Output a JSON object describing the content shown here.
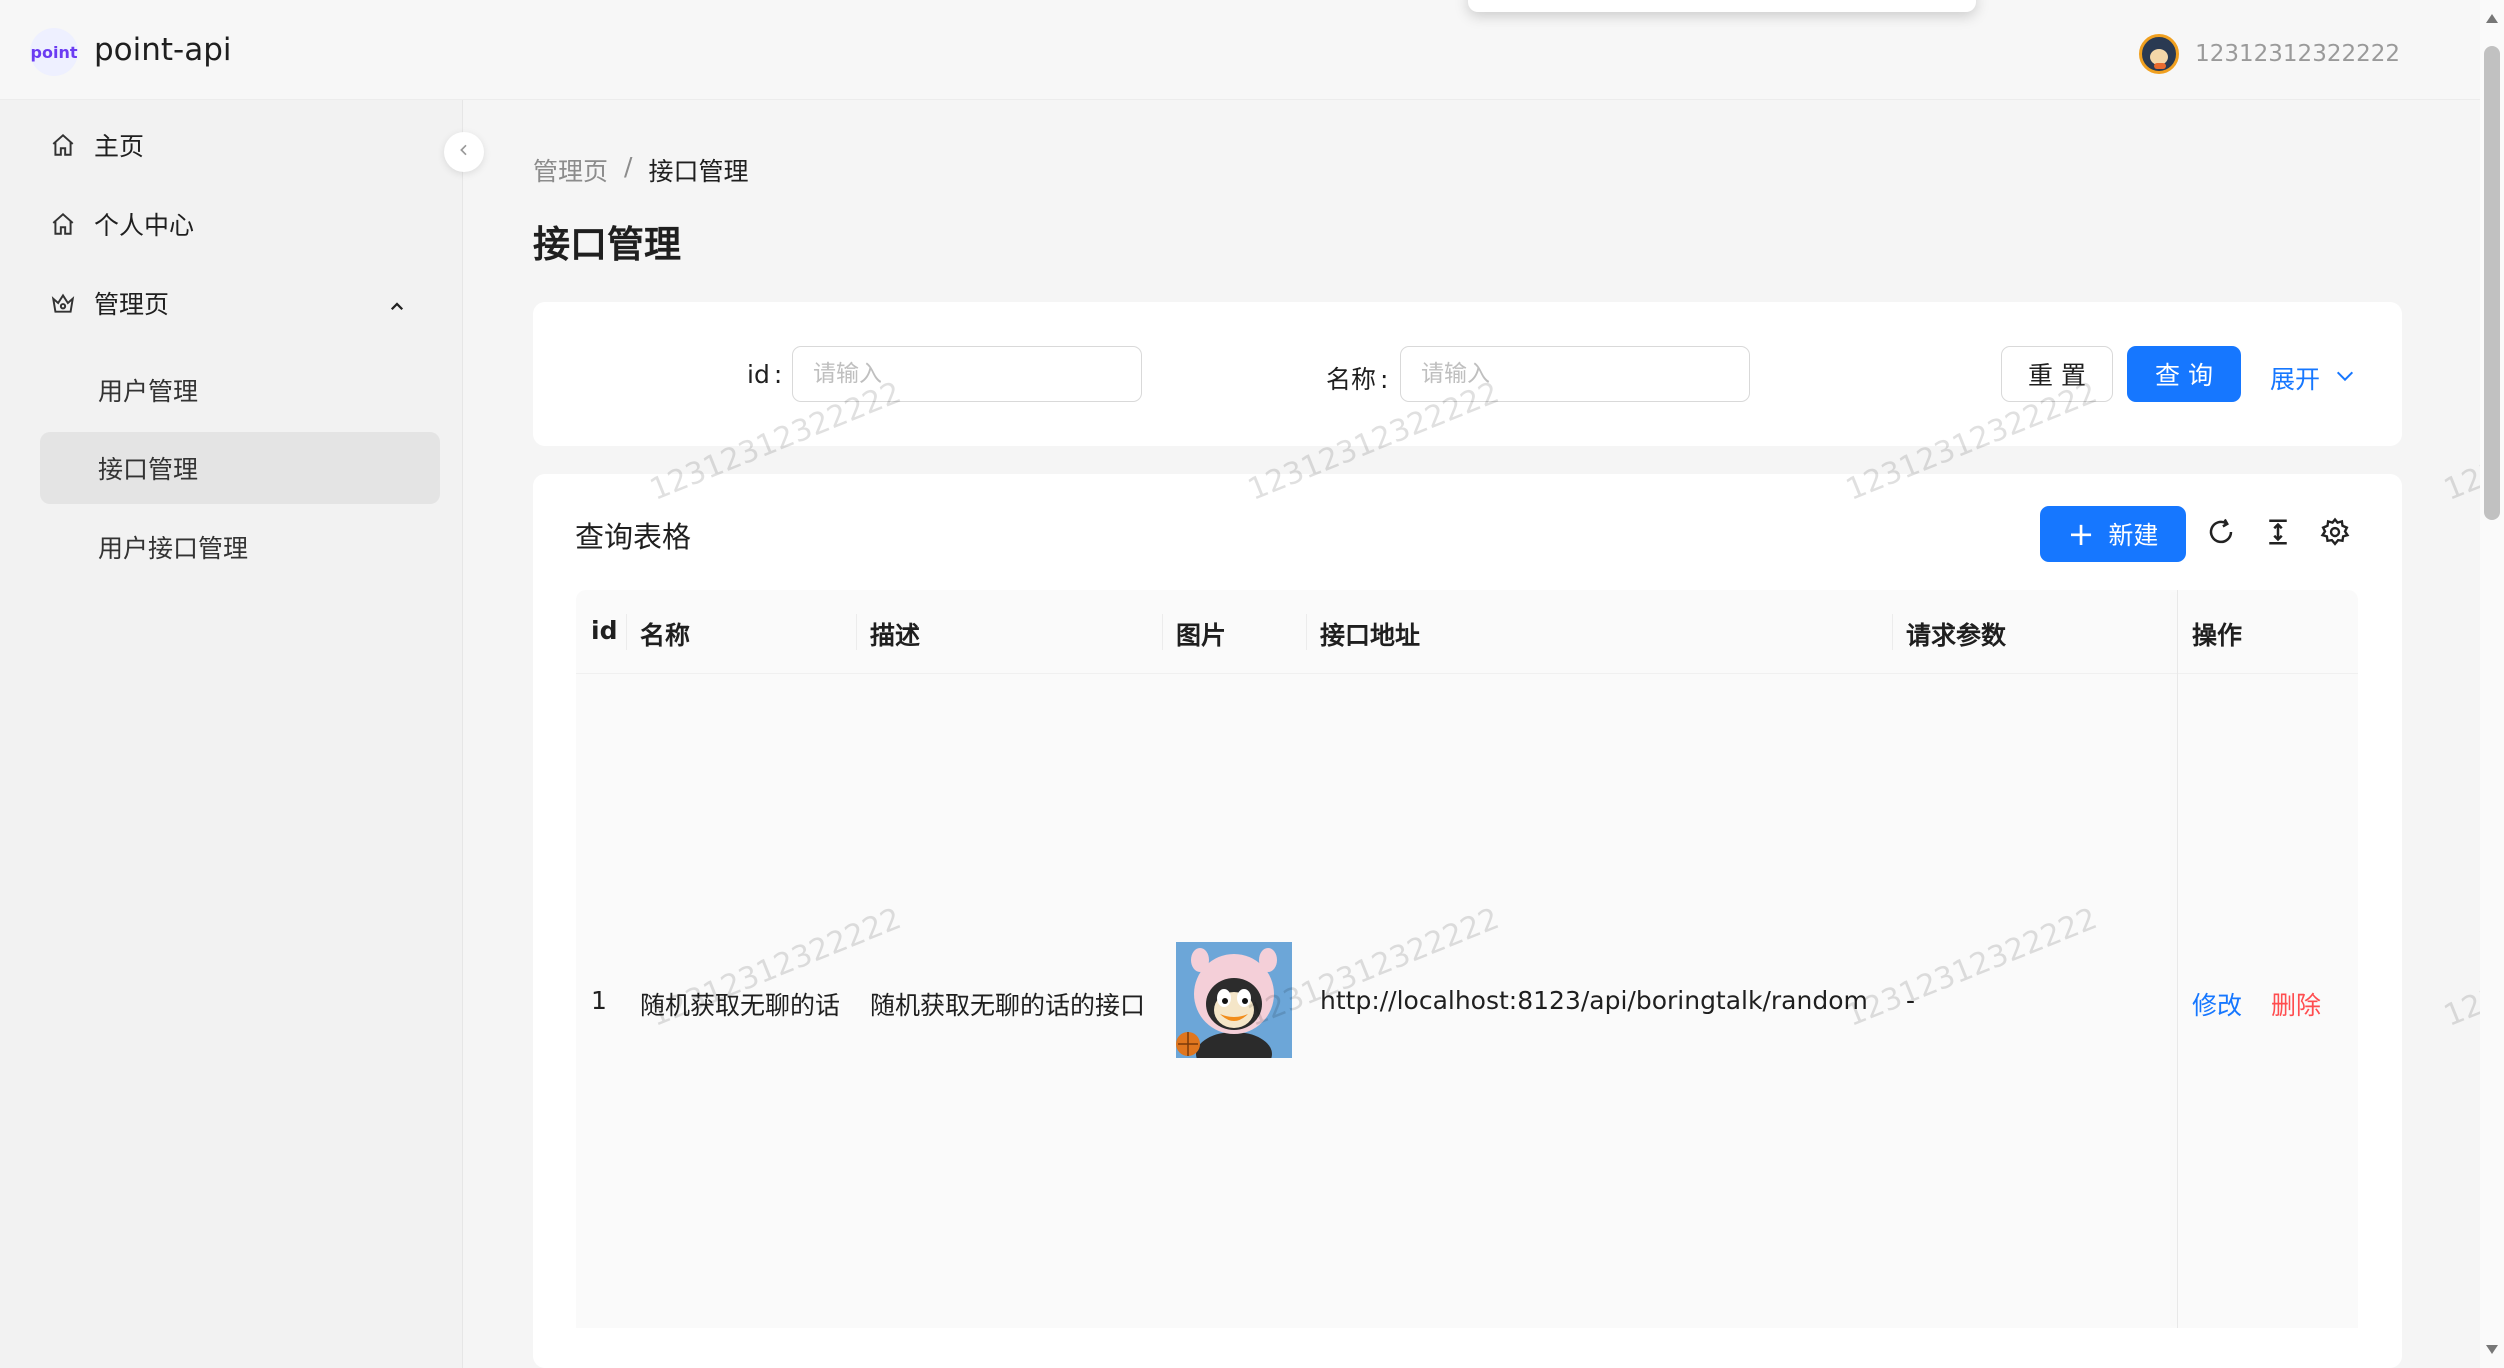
{
  "app": {
    "logo_text": "point",
    "title": "point-api"
  },
  "user": {
    "name": "12312312322222"
  },
  "sidebar": {
    "items": [
      {
        "label": "主页",
        "icon": "home-icon"
      },
      {
        "label": "个人中心",
        "icon": "home-icon"
      },
      {
        "label": "管理页",
        "icon": "crown-icon",
        "expanded": true
      }
    ],
    "sub_items": [
      {
        "label": "用户管理"
      },
      {
        "label": "接口管理",
        "active": true
      },
      {
        "label": "用户接口管理"
      }
    ]
  },
  "breadcrumb": {
    "parent": "管理页",
    "separator": "/",
    "current": "接口管理"
  },
  "page_title": "接口管理",
  "search": {
    "id_label": "id",
    "name_label": "名称",
    "colon": ":",
    "id_placeholder": "请输入",
    "name_placeholder": "请输入",
    "reset_label": "重 置",
    "query_label": "查 询",
    "expand_label": "展开"
  },
  "table": {
    "title": "查询表格",
    "new_button": "新建",
    "new_button_plus": "+",
    "columns": [
      "id",
      "名称",
      "描述",
      "图片",
      "接口地址",
      "请求参数",
      "操作"
    ],
    "rows": [
      {
        "id": "1",
        "name": "随机获取无聊的话",
        "description": "随机获取无聊的话的接口",
        "url": "http://localhost:8123/api/boringtalk/random",
        "params": "-",
        "edit": "修改",
        "delete": "删除"
      }
    ]
  },
  "watermark": "12312312322222",
  "colors": {
    "primary": "#1677ff",
    "danger": "#ff4d4f",
    "logo": "#6b3cf2"
  }
}
